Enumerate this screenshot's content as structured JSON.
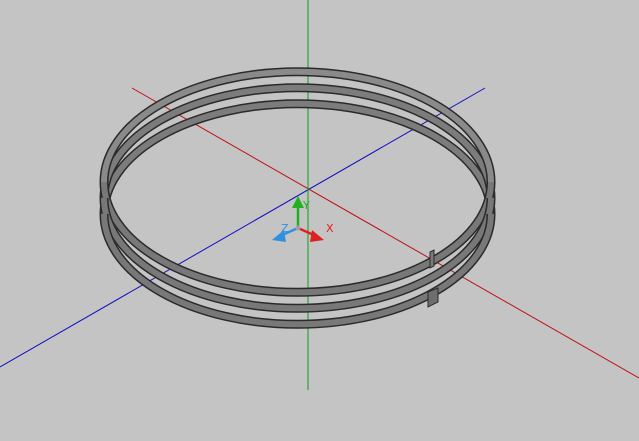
{
  "viewport": {
    "background": "#c4c4c4"
  },
  "axes": {
    "x_color": "#c01010",
    "y_color": "#10a010",
    "z_color": "#1010c0"
  },
  "ucs_icon": {
    "x_label": "X",
    "y_label": "Y",
    "z_label": "Z",
    "x_color": "#e02020",
    "y_color": "#20b020",
    "z_color": "#3090e0"
  },
  "model": {
    "object": "coil-spring",
    "turns": 3,
    "fill_color": "#787878",
    "edge_color": "#2a2a2a"
  }
}
